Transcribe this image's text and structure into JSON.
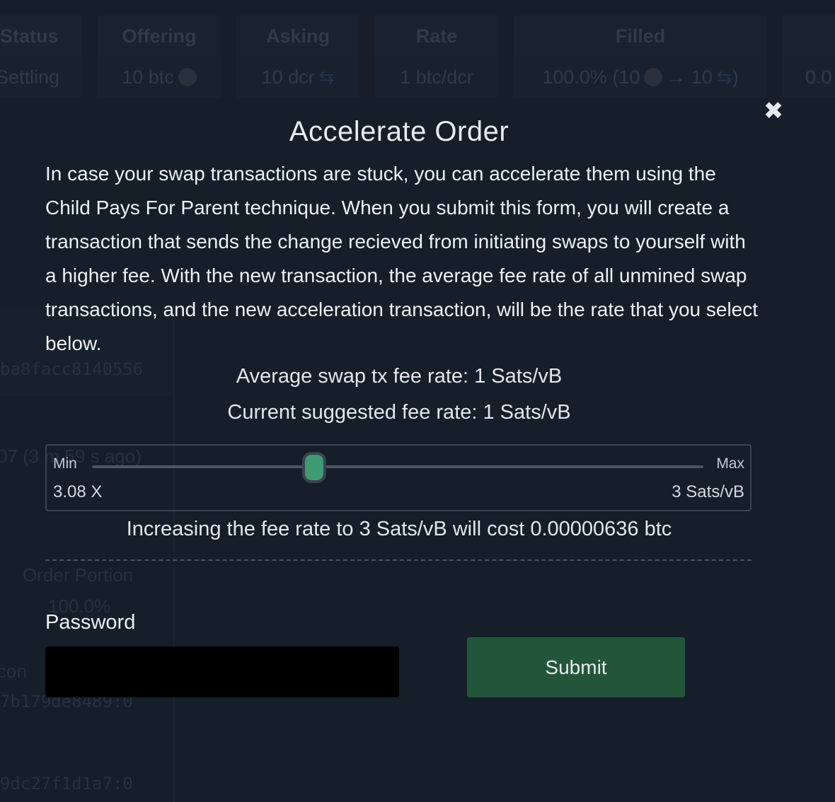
{
  "background": {
    "table_headers": [
      "Status",
      "Offering",
      "Asking",
      "Rate",
      "Filled"
    ],
    "table_row": {
      "status": "Settling",
      "offering": "10 btc",
      "asking": "10 dcr",
      "rate": "1 btc/dcr",
      "filled_prefix": "100.0% (10",
      "filled_mid": "→ 10",
      "filled_suffix": ")",
      "extra": "0.0"
    },
    "order_id_fragment": "ba8facc8140556",
    "time_fragment": "07 (3 m 59 s ago)",
    "order_portion_label": "Order Portion",
    "order_portion_value": "100.0%",
    "coin_fragment_a": "con",
    "hash_fragment_a": "7b179de8489:0",
    "hash_fragment_b": "9dc27f1d1a7:0"
  },
  "modal": {
    "title": "Accelerate Order",
    "description": "In case your swap transactions are stuck, you can accelerate them using the Child Pays For Parent technique. When you submit this form, you will create a transaction that sends the change recieved from initiating swaps to yourself with a higher fee. With the new transaction, the average fee rate of all unmined swap transactions, and the new acceleration transaction, will be the rate that you select below.",
    "average_fee_rate": "Average swap tx fee rate: 1 Sats/vB",
    "suggested_fee_rate": "Current suggested fee rate: 1 Sats/vB",
    "slider": {
      "min_label": "Min",
      "max_label": "Max",
      "multiplier": "3.08 X",
      "value_label": "3 Sats/vB",
      "position_fraction": 0.363,
      "handle_color": "#3f9a74"
    },
    "cost_text": "Increasing the fee rate to 3 Sats/vB will cost 0.00000636 btc",
    "password_label": "Password",
    "password_value": "",
    "submit_label": "Submit",
    "close_glyph": "✖"
  },
  "colors": {
    "background": "#151e29",
    "submit": "#23553a",
    "slider_handle": "#3f9a74"
  }
}
